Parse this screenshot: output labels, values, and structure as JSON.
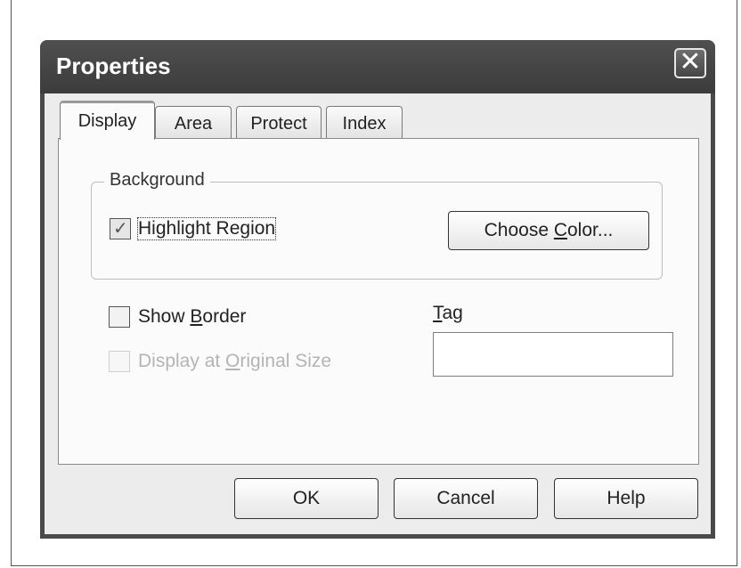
{
  "window": {
    "title": "Properties",
    "close_symbol": "✕"
  },
  "tabs": [
    {
      "label": "Display",
      "active": true
    },
    {
      "label": "Area",
      "active": false
    },
    {
      "label": "Protect",
      "active": false
    },
    {
      "label": "Index",
      "active": false
    }
  ],
  "background_group": {
    "label": "Background",
    "highlight_region": {
      "label": "Highlight Region",
      "checked": true
    },
    "choose_color_button": {
      "label_pre": "Choose ",
      "label_mnemonic": "C",
      "label_post": "olor..."
    }
  },
  "show_border": {
    "label_pre": "Show ",
    "label_mnemonic": "B",
    "label_post": "order",
    "checked": false
  },
  "display_original_size": {
    "label_pre": "Display at ",
    "label_mnemonic": "O",
    "label_post": "riginal Size",
    "checked": false,
    "enabled": false
  },
  "tag": {
    "label_mnemonic": "T",
    "label_post": "ag",
    "value": ""
  },
  "buttons": {
    "ok": "OK",
    "cancel": "Cancel",
    "help": "Help"
  },
  "icons": {
    "close": "close-icon",
    "check": "check-icon"
  }
}
